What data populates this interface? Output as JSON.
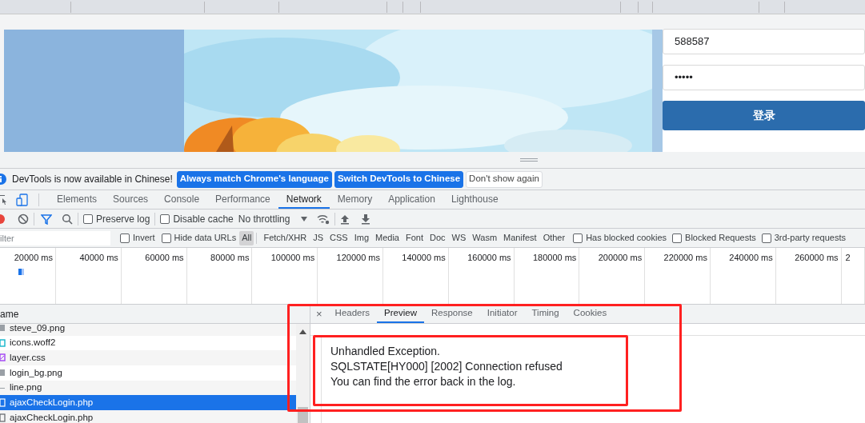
{
  "page": {
    "username": "588587",
    "password": "•••••",
    "login_button": "登录"
  },
  "infobar": {
    "message": "DevTools is now available in Chinese!",
    "buttons": [
      {
        "label": "Always match Chrome's language",
        "kind": "primary"
      },
      {
        "label": "Switch DevTools to Chinese",
        "kind": "primary"
      },
      {
        "label": "Don't show again",
        "kind": "plain"
      }
    ]
  },
  "tabs": [
    {
      "label": "Elements",
      "selected": false
    },
    {
      "label": "Sources",
      "selected": false
    },
    {
      "label": "Console",
      "selected": false
    },
    {
      "label": "Performance",
      "selected": false
    },
    {
      "label": "Network",
      "selected": true
    },
    {
      "label": "Memory",
      "selected": false
    },
    {
      "label": "Application",
      "selected": false
    },
    {
      "label": "Lighthouse",
      "selected": false
    }
  ],
  "toolbar": {
    "recording": true,
    "filter_active": true,
    "preserve_log": {
      "label": "Preserve log",
      "checked": false
    },
    "disable_cache": {
      "label": "Disable cache",
      "checked": false
    },
    "throttling": "No throttling"
  },
  "filter_bar": {
    "placeholder": "ilter",
    "invert": {
      "label": "Invert",
      "checked": false
    },
    "hide_data_urls": {
      "label": "Hide data URLs",
      "checked": false
    },
    "types": [
      {
        "label": "All",
        "selected": true
      },
      {
        "label": "Fetch/XHR",
        "selected": false
      },
      {
        "label": "JS",
        "selected": false
      },
      {
        "label": "CSS",
        "selected": false
      },
      {
        "label": "Img",
        "selected": false
      },
      {
        "label": "Media",
        "selected": false
      },
      {
        "label": "Font",
        "selected": false
      },
      {
        "label": "Doc",
        "selected": false
      },
      {
        "label": "WS",
        "selected": false
      },
      {
        "label": "Wasm",
        "selected": false
      },
      {
        "label": "Manifest",
        "selected": false
      },
      {
        "label": "Other",
        "selected": false
      }
    ],
    "options": [
      {
        "label": "Has blocked cookies",
        "checked": false
      },
      {
        "label": "Blocked Requests",
        "checked": false
      },
      {
        "label": "3rd-party requests",
        "checked": false
      }
    ]
  },
  "timeline": {
    "ticks": [
      "20000 ms",
      "40000 ms",
      "60000 ms",
      "80000 ms",
      "100000 ms",
      "120000 ms",
      "140000 ms",
      "160000 ms",
      "180000 ms",
      "200000 ms",
      "220000 ms",
      "240000 ms",
      "260000 ms",
      "2"
    ]
  },
  "requests": {
    "column": "ame",
    "rows": [
      {
        "name": "steve_09.png",
        "selected": false
      },
      {
        "name": "icons.woff2",
        "kind": "font",
        "selected": false
      },
      {
        "name": "layer.css",
        "kind": "stylesheet",
        "selected": false
      },
      {
        "name": "login_bg.png",
        "selected": false
      },
      {
        "name": "line.png",
        "kind": "other",
        "selected": false
      },
      {
        "name": "ajaxCheckLogin.php",
        "kind": "document",
        "selected": true
      },
      {
        "name": "ajaxCheckLogin.php",
        "kind": "document",
        "selected": false
      }
    ]
  },
  "details": {
    "close": "×",
    "tabs": [
      {
        "label": "Headers",
        "selected": false
      },
      {
        "label": "Preview",
        "selected": true
      },
      {
        "label": "Response",
        "selected": false
      },
      {
        "label": "Initiator",
        "selected": false
      },
      {
        "label": "Timing",
        "selected": false
      },
      {
        "label": "Cookies",
        "selected": false
      }
    ],
    "preview": [
      "Unhandled Exception.",
      "SQLSTATE[HY000] [2002] Connection refused",
      "You can find the error back in the log."
    ]
  }
}
